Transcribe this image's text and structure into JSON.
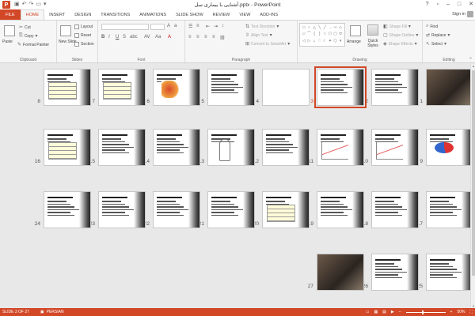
{
  "window": {
    "title": "آشنایی با بیماری سل.pptx - PowerPoint",
    "app_icon": "P",
    "sign_in": "Sign in",
    "controls": [
      "?",
      "▫",
      "–",
      "□",
      "✕"
    ]
  },
  "tabs": [
    "FILE",
    "HOME",
    "INSERT",
    "DESIGN",
    "TRANSITIONS",
    "ANIMATIONS",
    "SLIDE SHOW",
    "REVIEW",
    "VIEW",
    "ADD-INS"
  ],
  "ribbon": {
    "clipboard": {
      "label": "Clipboard",
      "paste": "Paste",
      "cut": "Cut",
      "copy": "Copy",
      "format_painter": "Format Painter"
    },
    "slides": {
      "label": "Slides",
      "new_slide": "New Slide",
      "layout": "Layout",
      "reset": "Reset",
      "section": "Section"
    },
    "font": {
      "label": "Font"
    },
    "paragraph": {
      "label": "Paragraph",
      "text_direction": "Text Direction",
      "align_text": "Align Text",
      "convert_smartart": "Convert to SmartArt"
    },
    "drawing": {
      "label": "Drawing",
      "arrange": "Arrange",
      "quick_styles": "Quick Styles",
      "shape_fill": "Shape Fill",
      "shape_outline": "Shape Outline",
      "shape_effects": "Shape Effects"
    },
    "editing": {
      "label": "Editing",
      "find": "Find",
      "replace": "Replace",
      "select": "Select"
    }
  },
  "slides": [
    {
      "n": "1",
      "kind": "photo"
    },
    {
      "n": "2",
      "kind": "text"
    },
    {
      "n": "3",
      "kind": "text",
      "selected": true
    },
    {
      "n": "4",
      "kind": "blank"
    },
    {
      "n": "5",
      "kind": "text"
    },
    {
      "n": "6",
      "kind": "map"
    },
    {
      "n": "7",
      "kind": "table"
    },
    {
      "n": "8",
      "kind": "table"
    },
    {
      "n": "9",
      "kind": "pie"
    },
    {
      "n": "10",
      "kind": "chart"
    },
    {
      "n": "11",
      "kind": "chart"
    },
    {
      "n": "12",
      "kind": "text"
    },
    {
      "n": "13",
      "kind": "figure"
    },
    {
      "n": "14",
      "kind": "text"
    },
    {
      "n": "15",
      "kind": "text"
    },
    {
      "n": "16",
      "kind": "table"
    },
    {
      "n": "17",
      "kind": "text"
    },
    {
      "n": "18",
      "kind": "text"
    },
    {
      "n": "19",
      "kind": "text"
    },
    {
      "n": "20",
      "kind": "table"
    },
    {
      "n": "21",
      "kind": "text"
    },
    {
      "n": "22",
      "kind": "text"
    },
    {
      "n": "23",
      "kind": "text"
    },
    {
      "n": "24",
      "kind": "text"
    },
    {
      "n": "25",
      "kind": "text"
    },
    {
      "n": "26",
      "kind": "text"
    },
    {
      "n": "27",
      "kind": "photo"
    }
  ],
  "statusbar": {
    "slide_info": "SLIDE 3 OF 27",
    "language": "PERSIAN",
    "zoom": "50%"
  },
  "colors": {
    "accent": "#d24726",
    "selection": "#d24726"
  }
}
